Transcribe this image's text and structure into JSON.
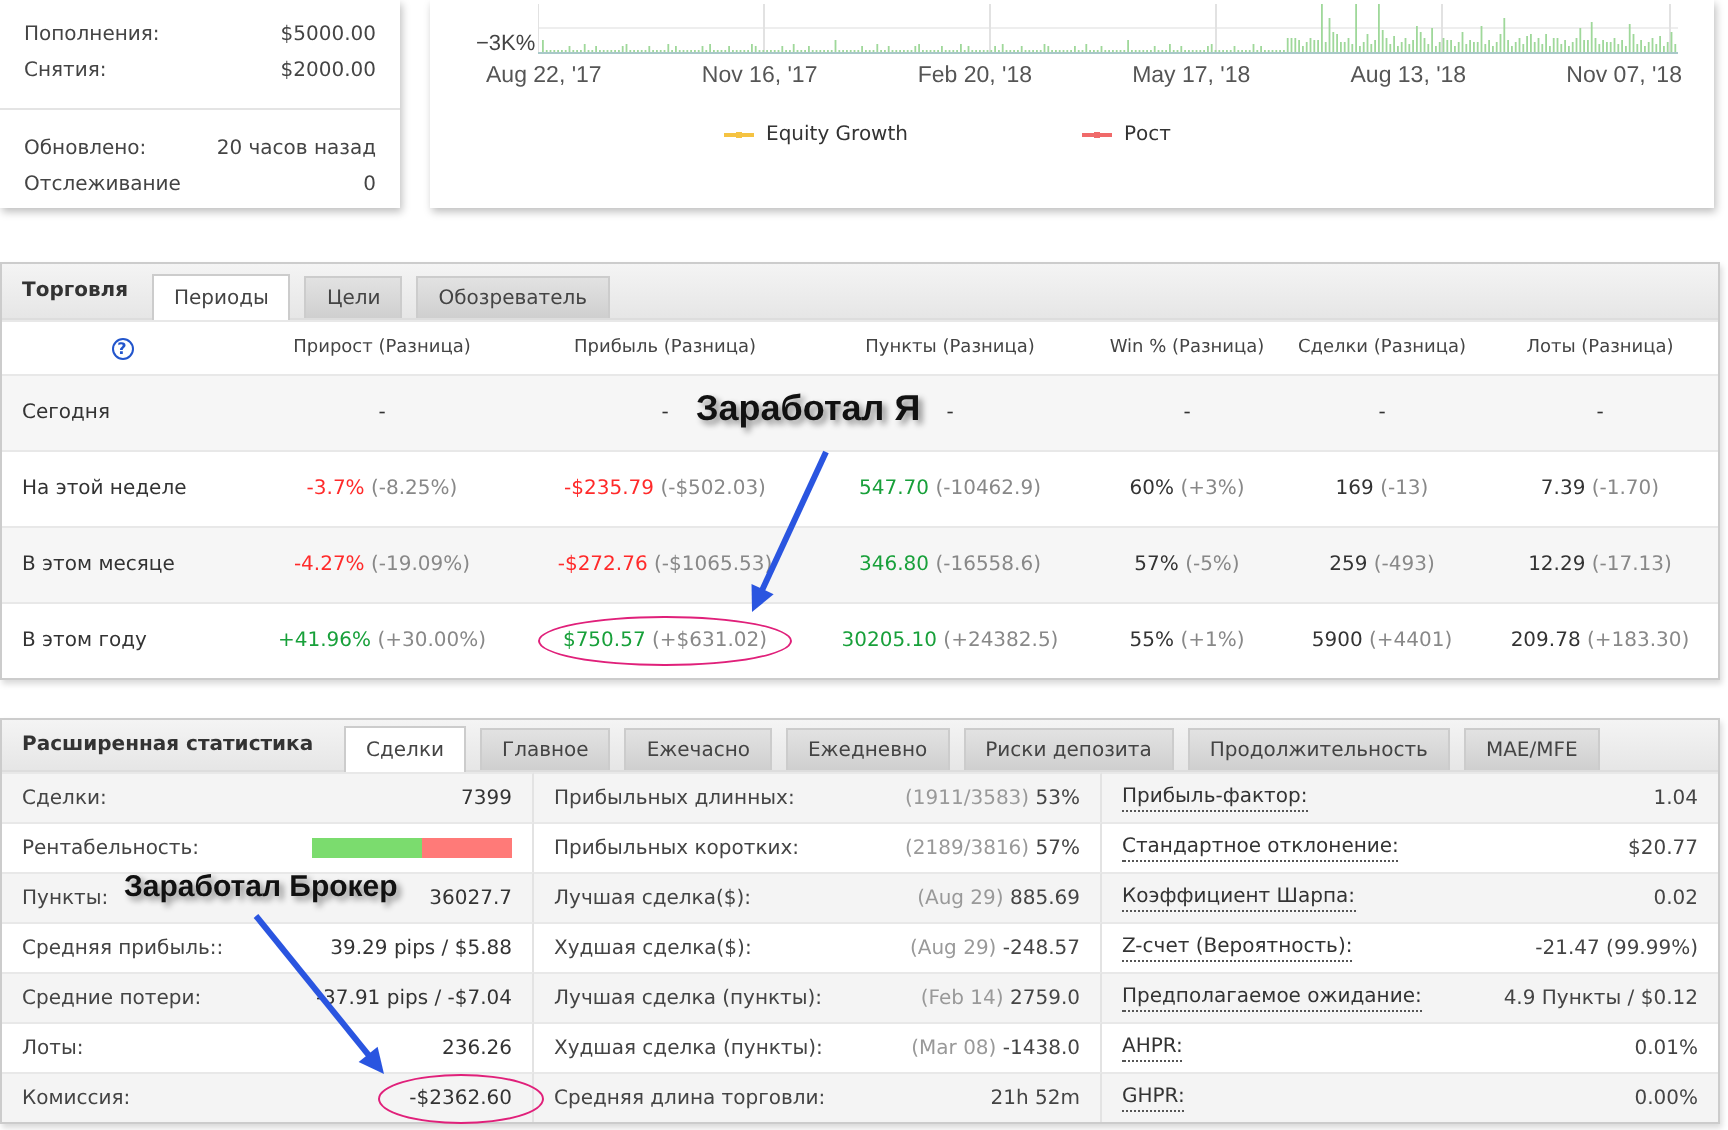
{
  "account_summary": {
    "groups": [
      [
        {
          "label": "Пополнения:",
          "value": "$5000.00"
        },
        {
          "label": "Снятия:",
          "value": "$2000.00"
        }
      ],
      [
        {
          "label": "Обновлено:",
          "value": "20 часов назад"
        },
        {
          "label": "Отслеживание",
          "value": "0"
        }
      ]
    ]
  },
  "growth_chart": {
    "y_tick": "−3K%",
    "x_labels": [
      "Aug 22, '17",
      "Nov 16, '17",
      "Feb 20, '18",
      "May 17, '18",
      "Aug 13, '18",
      "Nov 07, '18"
    ],
    "legend": [
      {
        "label": "Equity Growth",
        "color": "#f5c342"
      },
      {
        "label": "Рост",
        "color": "#f06a6a"
      }
    ]
  },
  "trading": {
    "title": "Торговля",
    "tabs": [
      {
        "label": "Периоды",
        "selected": true
      },
      {
        "label": "Цели",
        "selected": false
      },
      {
        "label": "Обозреватель",
        "selected": false
      }
    ],
    "help": "?",
    "columns": [
      "Прирост (Разница)",
      "Прибыль (Разница)",
      "Пункты (Разница)",
      "Win % (Разница)",
      "Сделки (Разница)",
      "Лоты (Разница)"
    ],
    "rows": [
      {
        "period": "Сегодня",
        "cells": [
          {
            "value": "-",
            "color": "#333333"
          },
          {
            "value": "-",
            "color": "#333333"
          },
          {
            "value": "-",
            "color": "#333333"
          },
          {
            "value": "-",
            "color": "#333333"
          },
          {
            "value": "-",
            "color": "#333333"
          },
          {
            "value": "-",
            "color": "#333333"
          }
        ]
      },
      {
        "period": "На этой неделе",
        "cells": [
          {
            "value": "-3.7%",
            "diff": "(-8.25%)",
            "color": "#ff2a2a"
          },
          {
            "value": "-$235.79",
            "diff": "(-$502.03)",
            "color": "#ff2a2a"
          },
          {
            "value": "547.70",
            "diff": "(-10462.9)",
            "color": "#18a03a"
          },
          {
            "value": "60%",
            "diff": "(+3%)",
            "color": "#333333"
          },
          {
            "value": "169",
            "diff": "(-13)",
            "color": "#333333"
          },
          {
            "value": "7.39",
            "diff": "(-1.70)",
            "color": "#333333"
          }
        ]
      },
      {
        "period": "В этом месяце",
        "cells": [
          {
            "value": "-4.27%",
            "diff": "(-19.09%)",
            "color": "#ff2a2a"
          },
          {
            "value": "-$272.76",
            "diff": "(-$1065.53)",
            "color": "#ff2a2a"
          },
          {
            "value": "346.80",
            "diff": "(-16558.6)",
            "color": "#18a03a"
          },
          {
            "value": "57%",
            "diff": "(-5%)",
            "color": "#333333"
          },
          {
            "value": "259",
            "diff": "(-493)",
            "color": "#333333"
          },
          {
            "value": "12.29",
            "diff": "(-17.13)",
            "color": "#333333"
          }
        ]
      },
      {
        "period": "В этом году",
        "cells": [
          {
            "value": "+41.96%",
            "diff": "(+30.00%)",
            "color": "#18a03a"
          },
          {
            "value": "$750.57",
            "diff": "(+$631.02)",
            "color": "#18a03a",
            "circled": true
          },
          {
            "value": "30205.10",
            "diff": "(+24382.5)",
            "color": "#18a03a"
          },
          {
            "value": "55%",
            "diff": "(+1%)",
            "color": "#333333"
          },
          {
            "value": "5900",
            "diff": "(+4401)",
            "color": "#333333"
          },
          {
            "value": "209.78",
            "diff": "(+183.30)",
            "color": "#333333"
          }
        ]
      }
    ]
  },
  "extended_stats": {
    "title": "Расширенная статистика",
    "tabs": [
      {
        "label": "Сделки",
        "selected": true
      },
      {
        "label": "Главное",
        "selected": false
      },
      {
        "label": "Ежечасно",
        "selected": false
      },
      {
        "label": "Ежедневно",
        "selected": false
      },
      {
        "label": "Риски депозита",
        "selected": false
      },
      {
        "label": "Продолжительность",
        "selected": false
      },
      {
        "label": "MAE/MFE",
        "selected": false
      }
    ],
    "rows": [
      [
        {
          "kind": "text",
          "label": "Сделки:",
          "value": "7399"
        },
        {
          "label": "Прибыльных длинных:",
          "note": "(1911/3583)",
          "value": "53%"
        },
        {
          "label": "Прибыль-фактор:",
          "value": "1.04"
        }
      ],
      [
        {
          "kind": "bar",
          "label": "Рентабельность:",
          "level": 0.55
        },
        {
          "label": "Прибыльных коротких:",
          "note": "(2189/3816)",
          "value": "57%"
        },
        {
          "label": "Стандартное отклонение:",
          "value": "$20.77"
        }
      ],
      [
        {
          "kind": "text",
          "label": "Пункты:",
          "value": "36027.7"
        },
        {
          "label": "Лучшая сделка($):",
          "note": "(Aug 29)",
          "value": "885.69"
        },
        {
          "label": "Коэффициент Шарпа:",
          "value": "0.02"
        }
      ],
      [
        {
          "kind": "text",
          "label": "Средняя прибыль::",
          "value": "39.29 pips / $5.88"
        },
        {
          "label": "Худшая сделка($):",
          "note": "(Aug 29)",
          "value": "-248.57"
        },
        {
          "label": "Z-счет (Вероятность):",
          "value": "-21.47 (99.99%)"
        }
      ],
      [
        {
          "kind": "text",
          "label": "Средние потери:",
          "value": "-37.91 pips / -$7.04"
        },
        {
          "label": "Лучшая сделка (пункты):",
          "note": "(Feb 14)",
          "value": "2759.0"
        },
        {
          "label": "Предполагаемое ожидание:",
          "value": "4.9 Пункты / $0.12"
        }
      ],
      [
        {
          "kind": "text",
          "label": "Лоты:",
          "value": "236.26"
        },
        {
          "label": "Худшая сделка (пункты):",
          "note": "(Mar 08)",
          "value": "-1438.0"
        },
        {
          "label": "AHPR:",
          "value": "0.01%"
        }
      ],
      [
        {
          "kind": "text",
          "label": "Комиссия:",
          "value": "-$2362.60",
          "circled": true
        },
        {
          "label": "Средняя длина торговли:",
          "value": "21h 52m"
        },
        {
          "label": "GHPR:",
          "value": "0.00%"
        }
      ]
    ]
  },
  "annotations": [
    {
      "text": "Заработал Я"
    },
    {
      "text": "Заработал Брокер"
    }
  ]
}
